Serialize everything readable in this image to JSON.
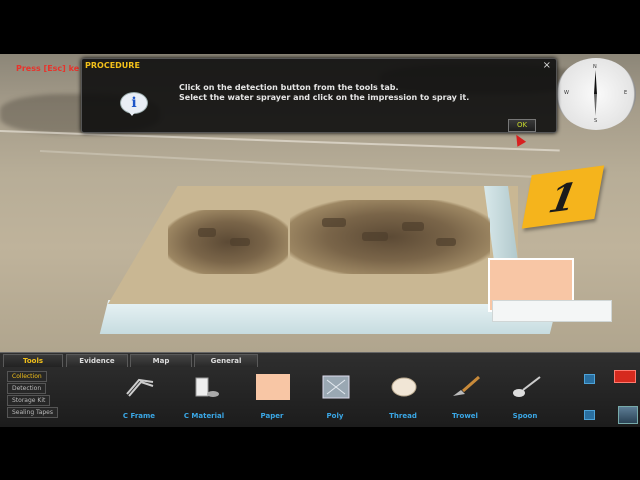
{
  "hint": {
    "text": "Press [Esc] ke"
  },
  "dialog": {
    "title": "PROCEDURE",
    "close": "×",
    "info_icon": "i",
    "lines": [
      "Click on the detection button from the tools tab.",
      "Select the water sprayer and click on the impression to spray it."
    ],
    "ok_label": "OK"
  },
  "marker": {
    "number": "1"
  },
  "compass": {
    "labels": [
      "N",
      "E",
      "S",
      "W"
    ]
  },
  "toolbar": {
    "tabs": [
      {
        "label": "Tools",
        "active": true
      },
      {
        "label": "Evidence",
        "active": false
      },
      {
        "label": "Map",
        "active": false
      },
      {
        "label": "General",
        "active": false
      }
    ],
    "side_buttons": [
      "Collection",
      "Detection",
      "Storage Kit",
      "Sealing Tapes"
    ],
    "tools": [
      {
        "label": "C Frame",
        "icon": "c-frame-icon"
      },
      {
        "label": "C Material",
        "icon": "casting-material-icon"
      },
      {
        "label": "Paper",
        "icon": "paper-icon"
      },
      {
        "label": "Poly",
        "icon": "poly-bag-icon"
      },
      {
        "label": "Thread",
        "icon": "thread-icon"
      },
      {
        "label": "Trowel",
        "icon": "trowel-icon"
      },
      {
        "label": "Spoon",
        "icon": "spoon-icon"
      }
    ]
  },
  "colors": {
    "accent": "#f2c01a",
    "tool_label": "#3aa7e6",
    "marker": "#f5b41c",
    "paper": "#f8c6a5"
  }
}
